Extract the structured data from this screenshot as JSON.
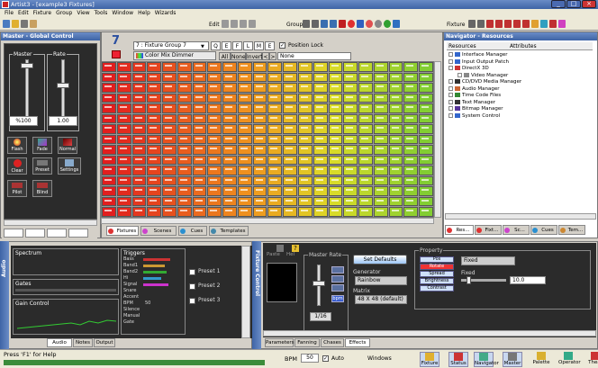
{
  "title": "Artist3 - [example3 Fixtures]",
  "menu": [
    "File",
    "Edit",
    "Fixture",
    "Group",
    "View",
    "Tools",
    "Window",
    "Help",
    "Wizards"
  ],
  "toolbar": {
    "edit": "Edit",
    "group": "Group",
    "fixture": "Fixture"
  },
  "master": {
    "title": "Master - Global Control",
    "label_master": "Master",
    "label_rate": "Rate",
    "val1": "%100",
    "val2": "1.00",
    "buttons": [
      "Flash",
      "Fade",
      "Normal",
      "Clear",
      "Preset",
      "Settings",
      "Pilot",
      "Blind"
    ]
  },
  "fixtures": {
    "number": "7",
    "group": "7 : Fixture Group 7",
    "letters": [
      "Q",
      "E",
      "F",
      "L",
      "M",
      "E"
    ],
    "position_lock": "Position Lock",
    "colormix": "Color Mix Dimmer",
    "all": "All",
    "none": "None",
    "invert": "Invert",
    "lt": "<",
    "gt": ">",
    "select": "None"
  },
  "tabs": [
    "Fixtures",
    "Scenes",
    "Cues",
    "Templates"
  ],
  "navigator": {
    "title": "Navigator - Resources",
    "col1": "Resources",
    "col2": "Attributes",
    "items": [
      "Interface Manager",
      "Input Output Patch",
      "DirectX 3D",
      "Video Manager",
      "CD/DVD Media Manager",
      "Audio Manager",
      "Time Code Files",
      "Text Manager",
      "Bitmap Manager",
      "System Control"
    ],
    "tabs": [
      "Res...",
      "Fixt...",
      "Sc...",
      "Cues",
      "Tem..."
    ]
  },
  "audio": {
    "spectrum": "Spectrum",
    "triggers": "Triggers",
    "gates": "Gates",
    "gain": "Gain Control",
    "trig_rows": [
      "Bass",
      "Band1",
      "Band2",
      "Hi",
      "Signal",
      "Snare",
      "Accent",
      "BPM",
      "Silence",
      "Manual",
      "Gate"
    ],
    "bpm": "50",
    "presets": [
      "Preset 1",
      "Preset 2",
      "Preset 3"
    ],
    "tabs": [
      "Audio",
      "Notes",
      "Output"
    ],
    "side": "Audio"
  },
  "effects": {
    "side": "Fixture Control",
    "paste": "Paste",
    "hel": "Hel",
    "master_rate": "Master Rate",
    "set_defaults": "Set Defaults",
    "generator": "Generator",
    "gen_val": "Rainbow",
    "matrix": "Matrix",
    "matrix_val": "48 X 48 (default)",
    "rate_val": "1/16",
    "bpm": "bpm",
    "property": "Property",
    "prop_btns": [
      "Pos",
      "Rotate",
      "Spread",
      "Brightness",
      "Contrast"
    ],
    "fixed": "Fixed",
    "fixed2": "Fixed",
    "fixed_val": "10.0",
    "tabs": [
      "Parameters",
      "Fanning",
      "Chases",
      "Effects"
    ]
  },
  "status": {
    "help": "Press 'F1' for Help",
    "bpm": "BPM",
    "bpm_val": "50",
    "auto": "Auto",
    "windows": "Windows",
    "items": [
      "Fixture",
      "Status",
      "Navigator",
      "Master",
      "Palette",
      "Operator",
      "Theat"
    ]
  },
  "colors": {
    "accent": "#3e64a6",
    "grid_start": "#e02020",
    "grid_end": "#8fd030"
  }
}
